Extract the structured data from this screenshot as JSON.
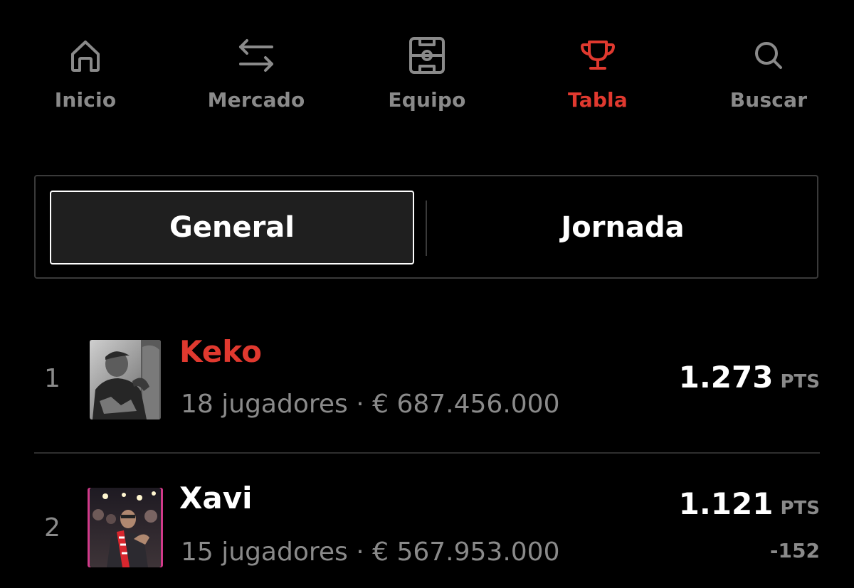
{
  "nav": {
    "items": [
      {
        "label": "Inicio",
        "icon": "home-icon",
        "active": false
      },
      {
        "label": "Mercado",
        "icon": "transfer-arrows-icon",
        "active": false
      },
      {
        "label": "Equipo",
        "icon": "pitch-icon",
        "active": false
      },
      {
        "label": "Tabla",
        "icon": "trophy-icon",
        "active": true
      },
      {
        "label": "Buscar",
        "icon": "search-icon",
        "active": false
      }
    ],
    "active_color": "#e0392f",
    "inactive_color": "#8a8a8a"
  },
  "tabs": {
    "general": "General",
    "jornada": "Jornada",
    "selected": "General"
  },
  "ranking": [
    {
      "rank": "1",
      "name": "Keko",
      "meta": "18 jugadores · € 687.456.000",
      "points": "1.273",
      "unit": "PTS",
      "highlight": true
    },
    {
      "rank": "2",
      "name": "Xavi",
      "meta": "15 jugadores · € 567.953.000",
      "points": "1.121",
      "unit": "PTS",
      "diff": "-152"
    }
  ],
  "colors": {
    "background": "#000000",
    "accent": "#e0392f",
    "muted": "#8a8a8a"
  }
}
